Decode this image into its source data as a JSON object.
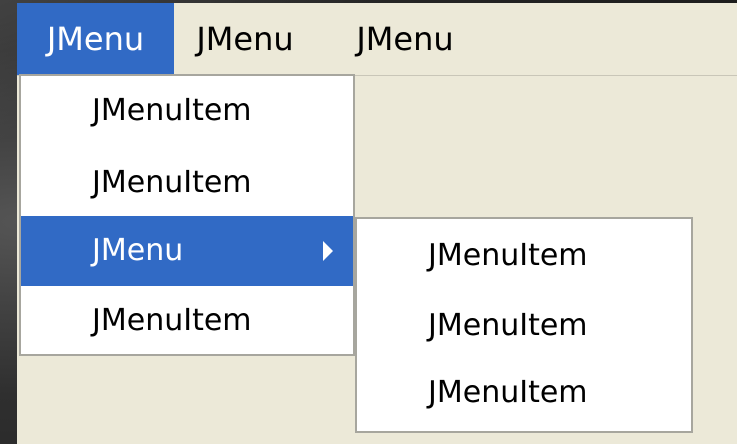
{
  "menubar": {
    "menus": [
      {
        "label": "JMenu",
        "state": "open"
      },
      {
        "label": "JMenu",
        "state": "closed"
      },
      {
        "label": "JMenu",
        "state": "closed"
      }
    ]
  },
  "open_menu": {
    "items": [
      {
        "label": "JMenuItem"
      },
      {
        "label": "JMenuItem"
      },
      {
        "label": "JMenu",
        "has_submenu": true,
        "highlighted": true,
        "submenu_icon": "triangle-right-icon"
      },
      {
        "label": "JMenuItem"
      }
    ]
  },
  "submenu": {
    "items": [
      {
        "label": "JMenuItem"
      },
      {
        "label": "JMenuItem"
      },
      {
        "label": "JMenuItem"
      }
    ]
  },
  "colors": {
    "highlight": "#316ac5",
    "highlight_text": "#ffffff",
    "menubar_background": "#ece9d8",
    "popup_background": "#ffffff",
    "popup_border": "#a7a69e"
  }
}
